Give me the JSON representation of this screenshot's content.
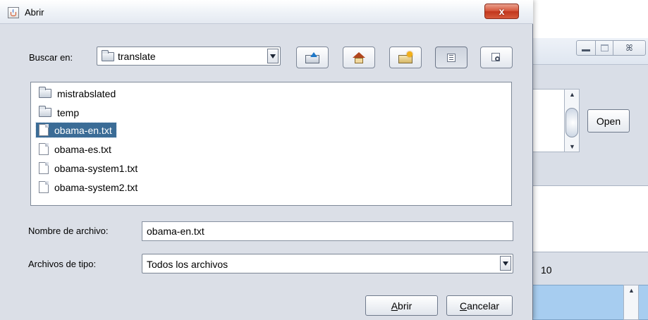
{
  "background_window": {
    "minimize_icon": "minimize-icon",
    "maximize_icon": "maximize-icon",
    "close_glyph": "ꕤ",
    "open_button_label": "Open",
    "number_value": "10",
    "scroll_up_glyph": "▲",
    "scroll_down_glyph": "▼"
  },
  "dialog": {
    "title": "Abrir",
    "close_glyph": "x",
    "look_in_label": "Buscar en:",
    "current_folder": "translate",
    "toolbar": {
      "up_icon": "up-folder-icon",
      "home_icon": "home-icon",
      "new_folder_icon": "new-folder-icon",
      "list_view_icon": "list-view-icon",
      "details_view_icon": "details-view-icon"
    },
    "files": [
      {
        "name": "mistrabslated",
        "kind": "folder",
        "selected": false
      },
      {
        "name": "temp",
        "kind": "folder",
        "selected": false
      },
      {
        "name": "obama-en.txt",
        "kind": "file",
        "selected": true
      },
      {
        "name": "obama-es.txt",
        "kind": "file",
        "selected": false
      },
      {
        "name": "obama-system1.txt",
        "kind": "file",
        "selected": false
      },
      {
        "name": "obama-system2.txt",
        "kind": "file",
        "selected": false
      }
    ],
    "file_name_label": "Nombre de archivo:",
    "file_name_value": "obama-en.txt",
    "file_type_label": "Archivos de tipo:",
    "file_type_value": "Todos los archivos",
    "open_button": {
      "mnemonic": "A",
      "rest": "brir"
    },
    "cancel_button": {
      "mnemonic": "C",
      "rest": "ancelar"
    }
  },
  "colors": {
    "selection": "#3b6c96",
    "dialog_bg": "#dbdfe7",
    "close_button": "#c2361c",
    "bg_list": "#a7cdf0"
  }
}
